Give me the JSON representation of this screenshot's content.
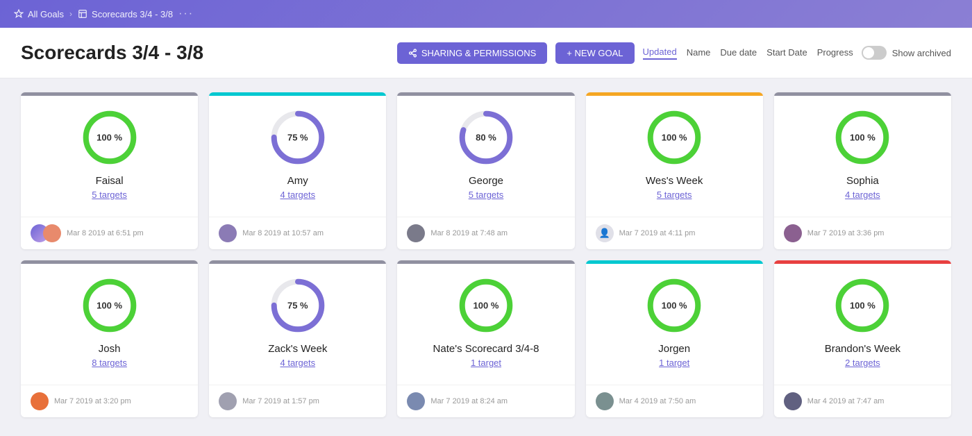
{
  "nav": {
    "allGoals": "All Goals",
    "scorecards": "Scorecards 3/4 - 3/8",
    "dots": "···"
  },
  "header": {
    "title": "Scorecards 3/4 - 3/8",
    "sharingBtn": "SHARING & PERMISSIONS",
    "newGoalBtn": "+ NEW GOAL",
    "sortOptions": [
      "Updated",
      "Name",
      "Due date",
      "Start Date",
      "Progress"
    ],
    "activeSort": "Updated",
    "showArchived": "Show archived"
  },
  "cards": [
    {
      "name": "Faisal",
      "targets": "5 targets",
      "progress": 100,
      "date": "Mar 8 2019 at 6:51 pm",
      "topBar": "gray",
      "avatarType": "double",
      "avatarClass": "av-faisal",
      "avatar2Class": "av-faisal2",
      "progressColor": "#4cd137",
      "progressTrack": "#e0f5e0"
    },
    {
      "name": "Amy",
      "targets": "4 targets",
      "progress": 75,
      "date": "Mar 8 2019 at 10:57 am",
      "topBar": "cyan",
      "avatarType": "single",
      "avatarClass": "av-amy",
      "progressColor": "#7c6fd5",
      "progressTrack": "#e8e4f8"
    },
    {
      "name": "George",
      "targets": "5 targets",
      "progress": 80,
      "date": "Mar 8 2019 at 7:48 am",
      "topBar": "gray",
      "avatarType": "single",
      "avatarClass": "av-george",
      "progressColor": "#7c6fd5",
      "progressTrack": "#e8e4f8"
    },
    {
      "name": "Wes's Week",
      "targets": "5 targets",
      "progress": 100,
      "date": "Mar 7 2019 at 4:11 pm",
      "topBar": "orange",
      "avatarType": "single",
      "avatarClass": "av-wes-icon",
      "progressColor": "#4cd137",
      "progressTrack": "#e0f5e0"
    },
    {
      "name": "Sophia",
      "targets": "4 targets",
      "progress": 100,
      "date": "Mar 7 2019 at 3:36 pm",
      "topBar": "gray",
      "avatarType": "single",
      "avatarClass": "av-sophia",
      "progressColor": "#4cd137",
      "progressTrack": "#e0f5e0"
    },
    {
      "name": "Josh",
      "targets": "8 targets",
      "progress": 100,
      "date": "Mar 7 2019 at 3:20 pm",
      "topBar": "gray",
      "avatarType": "single",
      "avatarClass": "av-josh",
      "progressColor": "#4cd137",
      "progressTrack": "#e0f5e0"
    },
    {
      "name": "Zack's Week",
      "targets": "4 targets",
      "progress": 75,
      "date": "Mar 7 2019 at 1:57 pm",
      "topBar": "gray",
      "avatarType": "single",
      "avatarClass": "av-zack",
      "progressColor": "#7c6fd5",
      "progressTrack": "#e8e4f8"
    },
    {
      "name": "Nate's Scorecard 3/4-8",
      "targets": "1 target",
      "progress": 100,
      "date": "Mar 7 2019 at 8:24 am",
      "topBar": "gray",
      "avatarType": "single",
      "avatarClass": "av-nate",
      "progressColor": "#4cd137",
      "progressTrack": "#e0f5e0"
    },
    {
      "name": "Jorgen",
      "targets": "1 target",
      "progress": 100,
      "date": "Mar 4 2019 at 7:50 am",
      "topBar": "cyan",
      "avatarType": "single",
      "avatarClass": "av-jorgen",
      "progressColor": "#4cd137",
      "progressTrack": "#e0f5e0"
    },
    {
      "name": "Brandon's Week",
      "targets": "2 targets",
      "progress": 100,
      "date": "Mar 4 2019 at 7:47 am",
      "topBar": "red",
      "avatarType": "single",
      "avatarClass": "av-brandon",
      "progressColor": "#4cd137",
      "progressTrack": "#e0f5e0"
    }
  ]
}
